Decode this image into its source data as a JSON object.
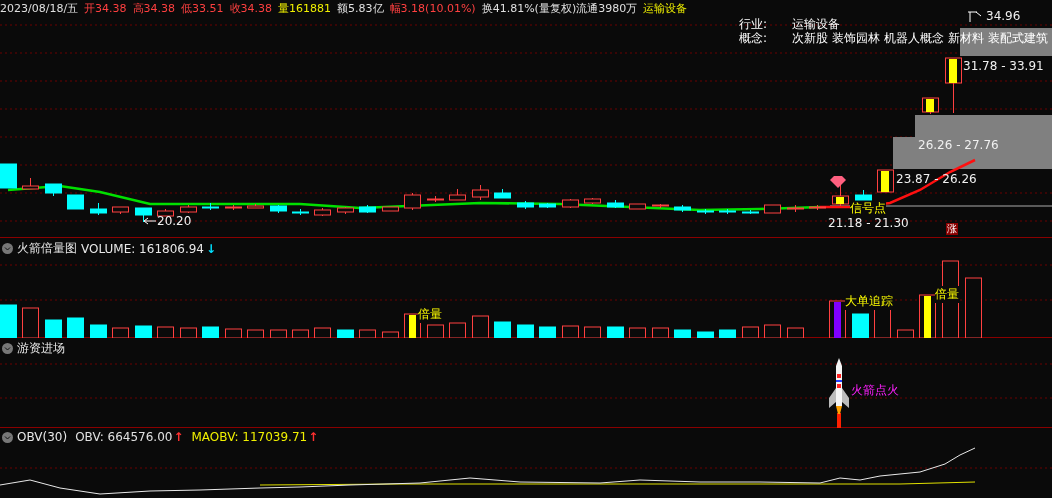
{
  "quote_bar": [
    {
      "text": "2023/08/18/五",
      "kind": "plain"
    },
    {
      "text": "开34.38",
      "kind": "up"
    },
    {
      "text": "高34.38",
      "kind": "up"
    },
    {
      "text": "低33.51",
      "kind": "up"
    },
    {
      "text": "收34.38",
      "kind": "up"
    },
    {
      "text": "量161881",
      "kind": "volume"
    },
    {
      "text": "额5.83亿",
      "kind": "plain"
    },
    {
      "text": "幅3.18(10.01%)",
      "kind": "up"
    },
    {
      "text": "换41.81%(量复权)流通3980万",
      "kind": "plain"
    },
    {
      "text": "运输设备",
      "kind": "volume"
    }
  ],
  "stock_info": {
    "industry_label": "行业:",
    "industry": "运输设备",
    "concept_label": "概念:",
    "concepts": [
      "次新股",
      "装饰园林",
      "机器人概念",
      "新材料",
      "装配式建筑"
    ]
  },
  "price_chart": {
    "low_label": "20.20",
    "high_label": "34.96",
    "zones": [
      {
        "range": "31.78 - 33.91"
      },
      {
        "range": "26.26 - 27.76"
      },
      {
        "range": "23.87 - 26.26"
      },
      {
        "range": "21.18 - 21.30"
      }
    ],
    "signal_label": "信号点",
    "limit_badge": "涨"
  },
  "volume_pane": {
    "title": "火箭倍量图",
    "reading": "VOLUME: 161806.94",
    "arrow": "↓",
    "markers": [
      "倍量",
      "大单追踪",
      "倍量"
    ]
  },
  "hot_money_pane": {
    "title": "游资进场",
    "signal_label": "火箭点火"
  },
  "obv_pane": {
    "title": "OBV(30)",
    "readings": [
      {
        "text": "OBV: 664576.00",
        "arrow": "↑",
        "kind": "obv"
      },
      {
        "text": "MAOBV: 117039.71",
        "arrow": "↑",
        "kind": "maobv"
      }
    ]
  }
}
